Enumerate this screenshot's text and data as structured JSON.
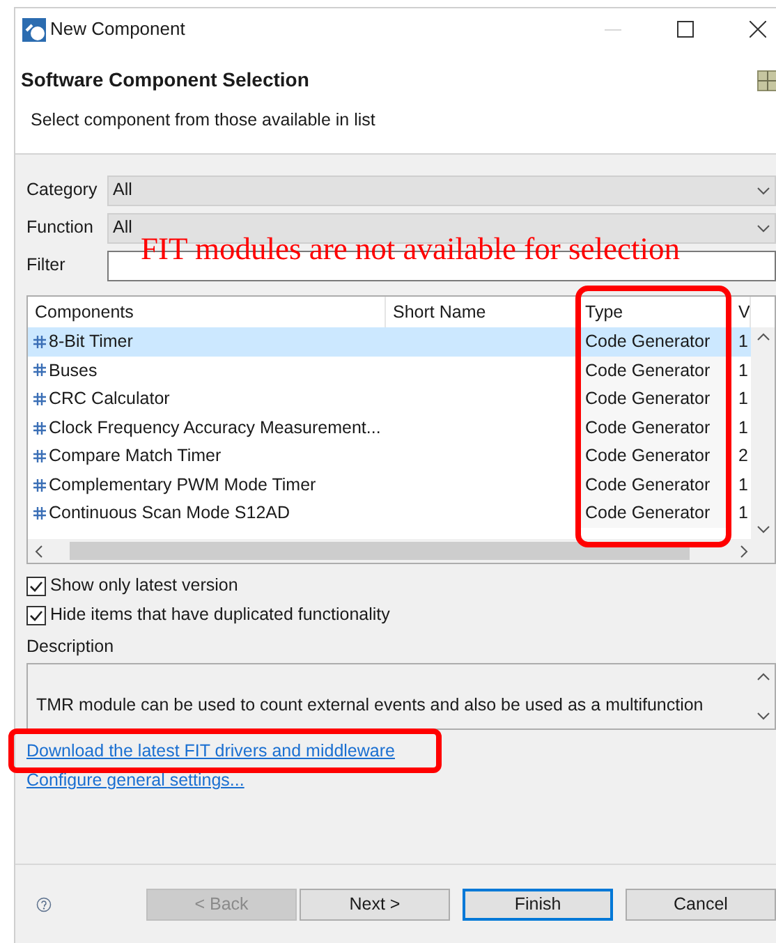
{
  "window": {
    "title": "New Component"
  },
  "header": {
    "title": "Software Component Selection",
    "subtitle": "Select component from those available in list"
  },
  "fields": [
    {
      "kind": "dropdown",
      "label": "Category",
      "value": "All"
    },
    {
      "kind": "dropdown",
      "label": "Function",
      "value": "All"
    },
    {
      "kind": "text",
      "label": "Filter"
    }
  ],
  "annotation_text": "FIT modules are not available for selection",
  "table": {
    "columns": [
      "Components",
      "Short Name",
      "Type",
      "V"
    ],
    "rows": [
      {
        "cells": [
          "8-Bit Timer",
          "",
          "Code Generator",
          "1"
        ],
        "selected": true
      },
      {
        "cells": [
          "Buses",
          "",
          "Code Generator",
          "1"
        ],
        "selected": false
      },
      {
        "cells": [
          "CRC Calculator",
          "",
          "Code Generator",
          "1"
        ],
        "selected": false
      },
      {
        "cells": [
          "Clock Frequency Accuracy Measurement...",
          "",
          "Code Generator",
          "1"
        ],
        "selected": false
      },
      {
        "cells": [
          "Compare Match Timer",
          "",
          "Code Generator",
          "2"
        ],
        "selected": false
      },
      {
        "cells": [
          "Complementary PWM Mode Timer",
          "",
          "Code Generator",
          "1"
        ],
        "selected": false
      },
      {
        "cells": [
          "Continuous Scan Mode S12AD",
          "",
          "Code Generator",
          "1"
        ],
        "selected": false
      }
    ]
  },
  "options": [
    {
      "label": "Show only latest version",
      "checked": true
    },
    {
      "label": "Hide items that have duplicated functionality",
      "checked": true
    }
  ],
  "description": {
    "label": "Description",
    "text": "TMR module can be used to count external events and also be used as a multifunction"
  },
  "links": [
    {
      "text": "Download the latest FIT drivers and middleware",
      "highlighted": true
    },
    {
      "text": "Configure general settings...",
      "highlighted": false
    }
  ],
  "buttons": [
    {
      "label": "< Back",
      "disabled": true,
      "default": false
    },
    {
      "label": "Next >",
      "disabled": false,
      "default": false
    },
    {
      "label": "Finish",
      "disabled": false,
      "default": true
    },
    {
      "label": "Cancel",
      "disabled": false,
      "default": false
    }
  ]
}
